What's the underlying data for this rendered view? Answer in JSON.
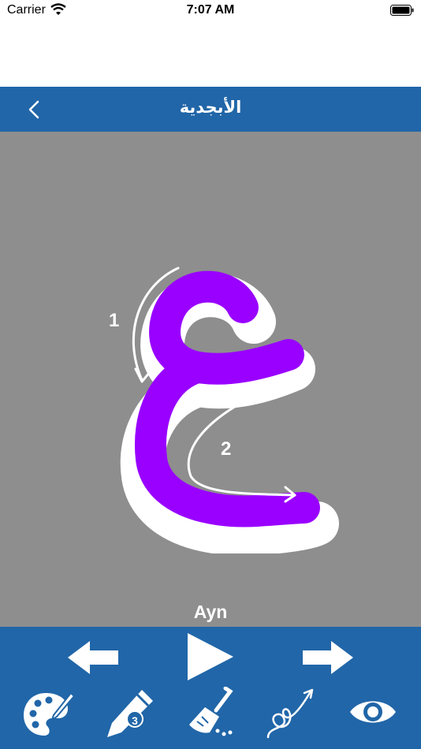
{
  "status_bar": {
    "carrier": "Carrier",
    "time": "7:07 AM"
  },
  "navbar": {
    "title": "الأبجدية"
  },
  "lesson": {
    "letter_name": "Ayn",
    "stroke_labels": [
      "1",
      "2"
    ]
  },
  "toolbar": {
    "pencil_badge": "3"
  },
  "colors": {
    "primary": "#2166a8",
    "canvas": "#8e8e8e",
    "stroke": "#9900ff"
  },
  "icons": {
    "back": "chevron-left-icon",
    "previous": "arrow-left-icon",
    "play": "play-icon",
    "next": "arrow-right-icon",
    "palette": "palette-icon",
    "pencil": "pencil-icon",
    "broom": "broom-icon",
    "trace": "trace-path-icon",
    "view": "eye-icon"
  }
}
